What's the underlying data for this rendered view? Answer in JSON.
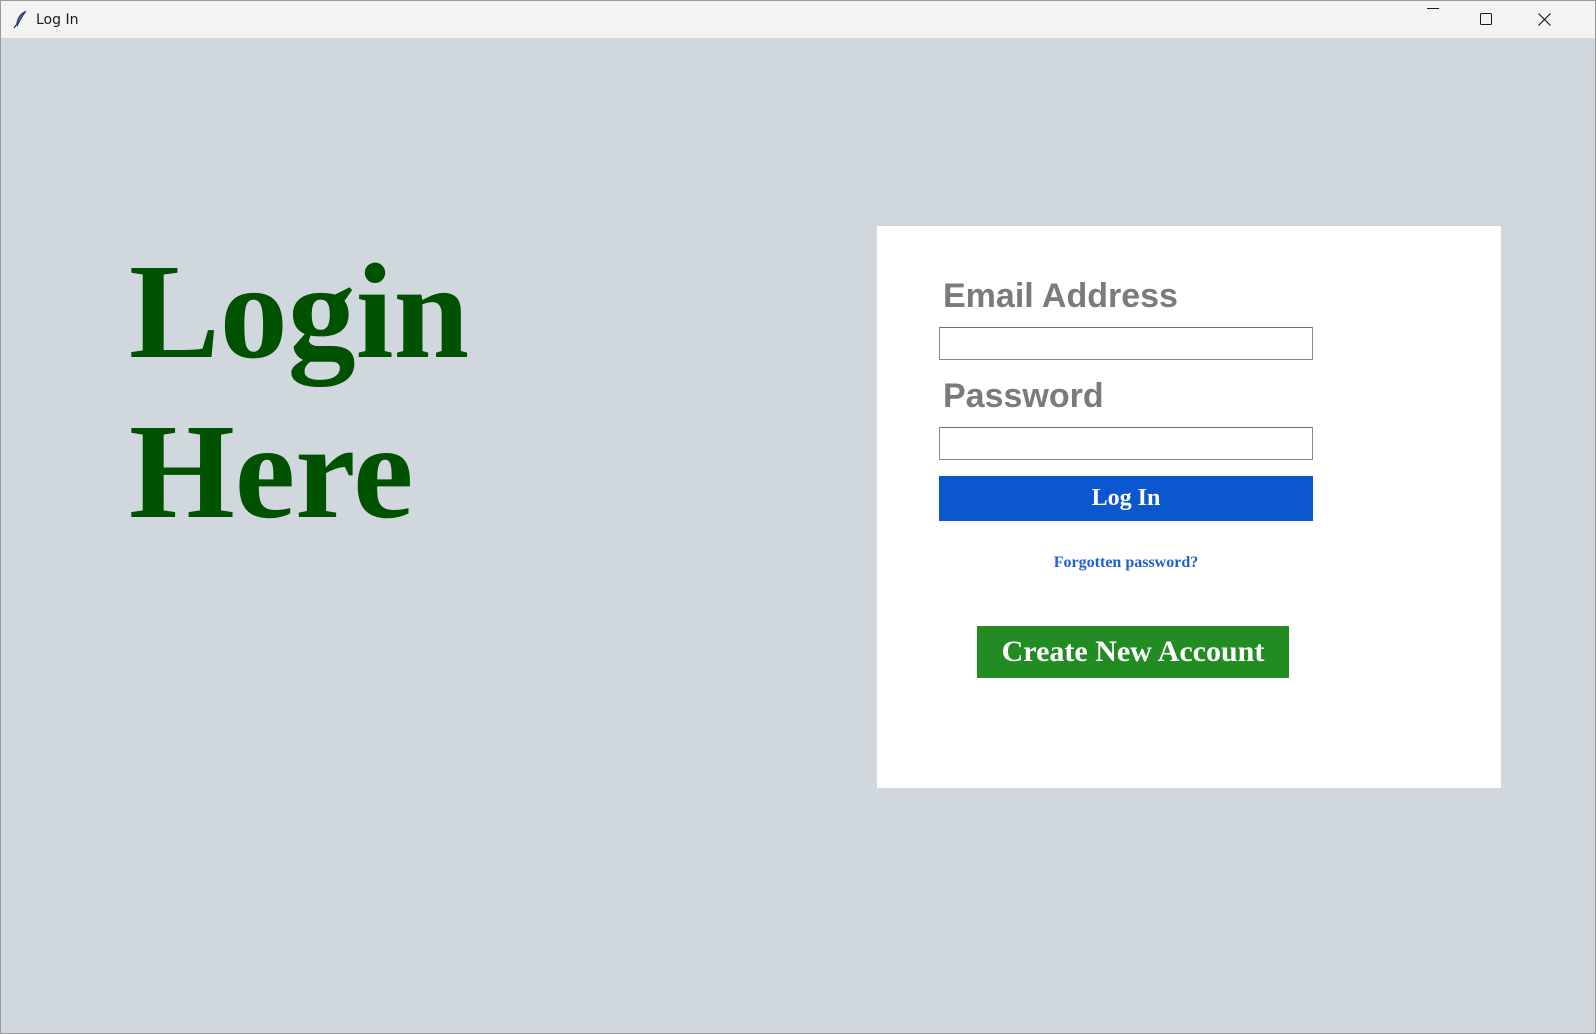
{
  "window": {
    "title": "Log In",
    "icon": "feather-icon",
    "controls": {
      "minimize": "minimize-icon",
      "maximize": "maximize-icon",
      "close": "close-icon"
    }
  },
  "hero": {
    "line1": "Login",
    "line2": "Here",
    "color": "#005200"
  },
  "form": {
    "email_label": "Email Address",
    "email_value": "",
    "password_label": "Password",
    "password_value": "",
    "login_button": "Log In",
    "forgot_link": "Forgotten password?",
    "create_button": "Create New Account"
  },
  "colors": {
    "background": "#d0d8de",
    "card": "#ffffff",
    "login_button": "#0b57d0",
    "create_button": "#228b22",
    "link": "#1f5fd6",
    "label": "#7b7b7b"
  }
}
